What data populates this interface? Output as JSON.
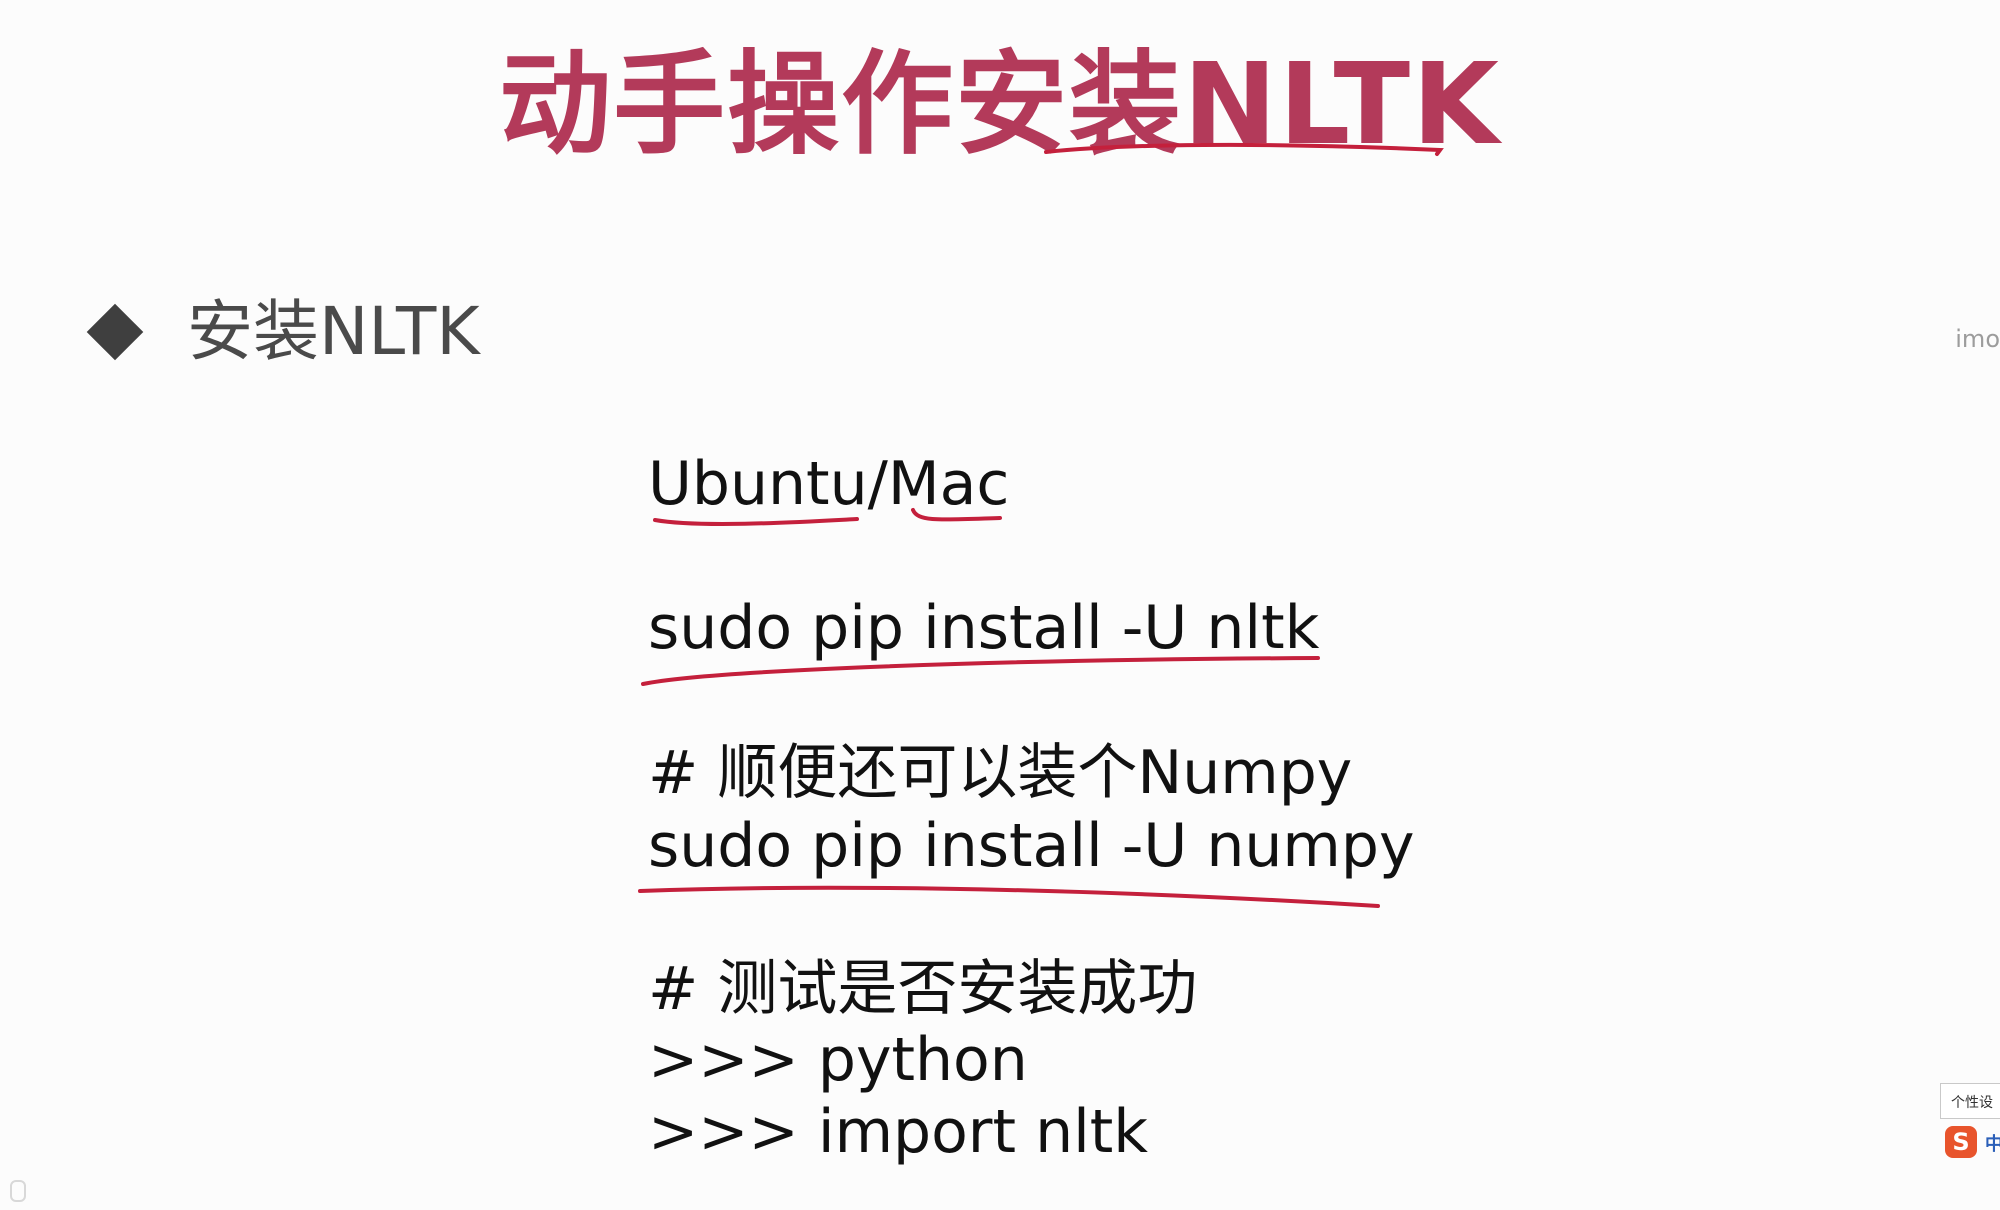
{
  "slide": {
    "title": "动手操作安装NLTK",
    "bullet": {
      "text": "安装NLTK"
    },
    "code_lines": [
      "Ubuntu/Mac",
      "sudo pip install -U nltk",
      "# 顺便还可以装个Numpy",
      "sudo pip install -U numpy",
      "# 测试是否安装成功",
      ">>> python",
      ">>> import nltk"
    ]
  },
  "overlay": {
    "corner_text": "imo",
    "ime_tooltip": "个性设",
    "ime_logo": "S",
    "ime_lang": "中"
  },
  "colors": {
    "title": "#b33a5a",
    "annotation_ink": "#c4203c"
  },
  "icons": {
    "bullet": "diamond-bullet-icon",
    "ime": "input-method-icon"
  }
}
